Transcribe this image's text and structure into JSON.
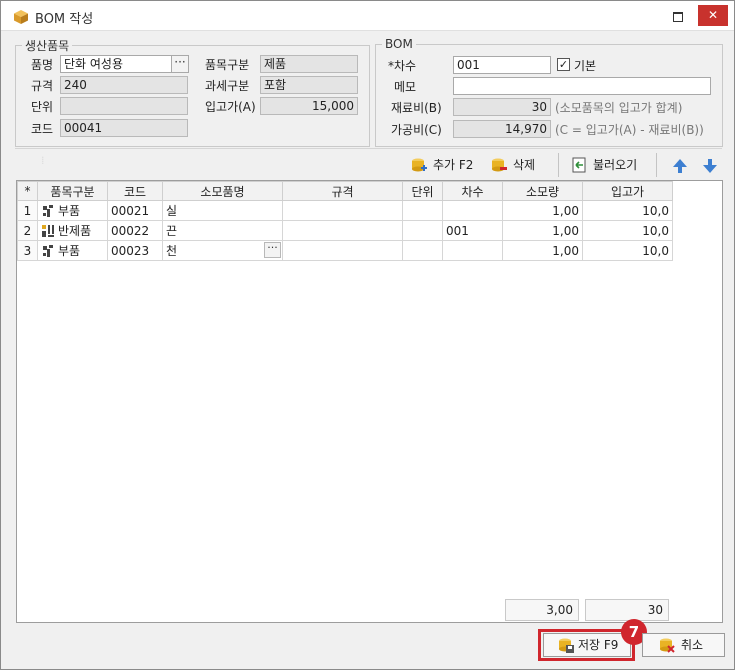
{
  "window": {
    "title": "BOM 작성",
    "close_glyph": "✕"
  },
  "product_group": {
    "legend": "생산품목",
    "name_label": "품명",
    "name_value": "단화 여성용",
    "spec_label": "규격",
    "spec_value": "240",
    "unit_label": "단위",
    "unit_value": "",
    "code_label": "코드",
    "code_value": "00041",
    "category_label": "품목구분",
    "category_value": "제품",
    "tax_label": "과세구분",
    "tax_value": "포함",
    "cost_label": "입고가(A)",
    "cost_value": "15,000"
  },
  "bom_group": {
    "legend": "BOM",
    "revision_label": "*차수",
    "revision_value": "001",
    "default_label": "기본",
    "default_checked": "✓",
    "memo_label": "메모",
    "memo_value": "",
    "material_label": "재료비(B)",
    "material_value": "30",
    "material_hint": "(소모품목의 입고가 합계)",
    "processing_label": "가공비(C)",
    "processing_value": "14,970",
    "processing_hint": "(C = 입고가(A) - 재료비(B))"
  },
  "toolbar": {
    "add_label": "추가 F2",
    "delete_label": "삭제",
    "import_label": "불러오기"
  },
  "grid": {
    "corner": "*",
    "columns": [
      "품목구분",
      "코드",
      "소모품명",
      "규격",
      "단위",
      "차수",
      "소모량",
      "입고가"
    ],
    "rows": [
      {
        "no": "1",
        "category": "부품",
        "code": "00021",
        "name": "실",
        "spec": "",
        "unit": "",
        "revision": "",
        "qty": "1,00",
        "price": "10,0"
      },
      {
        "no": "2",
        "category": "반제품",
        "code": "00022",
        "name": "끈",
        "spec": "",
        "unit": "",
        "revision": "001",
        "qty": "1,00",
        "price": "10,0"
      },
      {
        "no": "3",
        "category": "부품",
        "code": "00023",
        "name": "천",
        "spec": "",
        "unit": "",
        "revision": "",
        "qty": "1,00",
        "price": "10,0"
      }
    ],
    "totals": {
      "qty": "3,00",
      "price": "30"
    }
  },
  "buttons": {
    "save_label": "저장 F9",
    "cancel_label": "취소"
  },
  "annotation": {
    "step": "7"
  },
  "colors": {
    "accent_red": "#d0262d",
    "arrow_blue": "#3d7fd1",
    "db_yellow": "#e9b324"
  }
}
